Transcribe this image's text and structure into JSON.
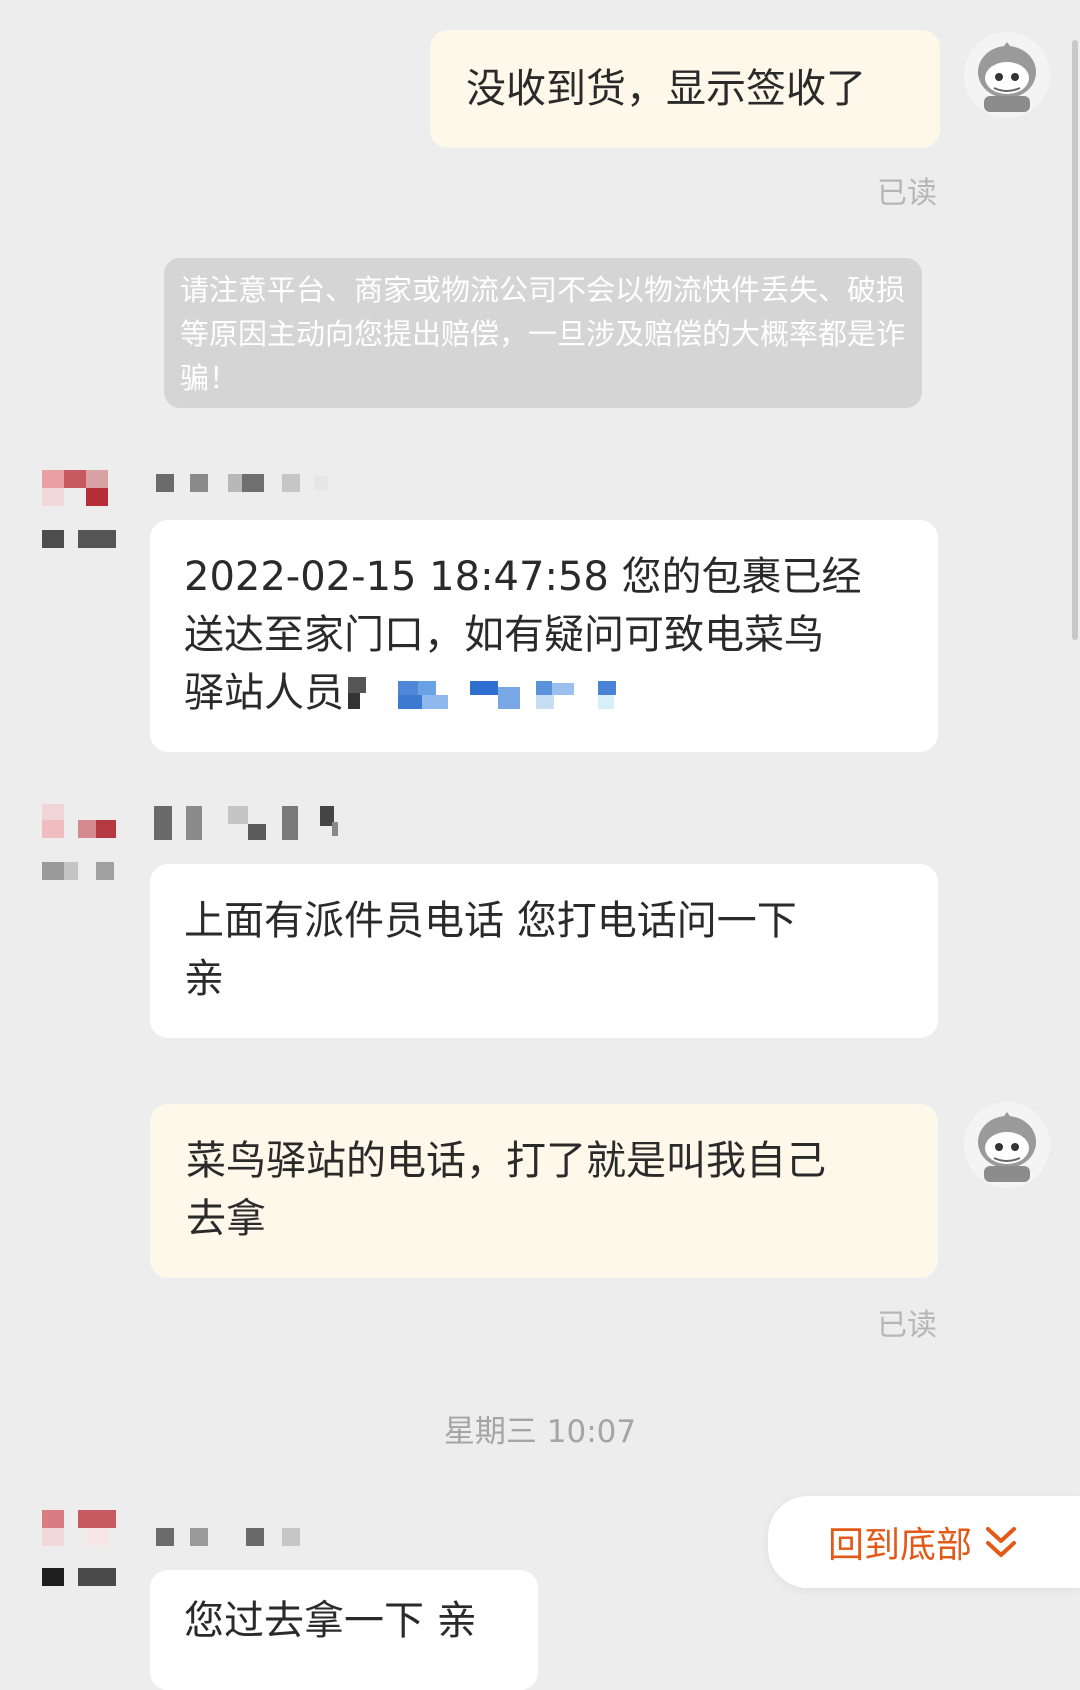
{
  "messages": {
    "m1": {
      "text": "没收到货，显示签收了",
      "read": "已读"
    },
    "notice": {
      "text": "请注意平台、商家或物流公司不会以物流快件丢失、破损等原因主动向您提出赔偿，一旦涉及赔偿的大概率都是诈骗！"
    },
    "m2": {
      "lines": [
        "2022-02-15 18:47:58  您的包裹已经",
        "送达至家门口，如有疑问可致电菜鸟",
        "驿站人员"
      ]
    },
    "m3": {
      "lines": [
        "上面有派件员电话 您打电话问一下",
        "亲"
      ]
    },
    "m4": {
      "lines": [
        "菜鸟驿站的电话，打了就是叫我自己",
        "去拿"
      ],
      "read": "已读"
    },
    "timestamp": "星期三 10:07",
    "m5": {
      "text": "您过去拿一下 亲"
    }
  },
  "scroll_to_bottom": {
    "label": "回到底部",
    "icon": "double-chevron-down-icon"
  },
  "colors": {
    "background": "#ededed",
    "outgoing_bubble": "#fdf8ea",
    "incoming_bubble": "#ffffff",
    "accent": "#e35a18"
  }
}
